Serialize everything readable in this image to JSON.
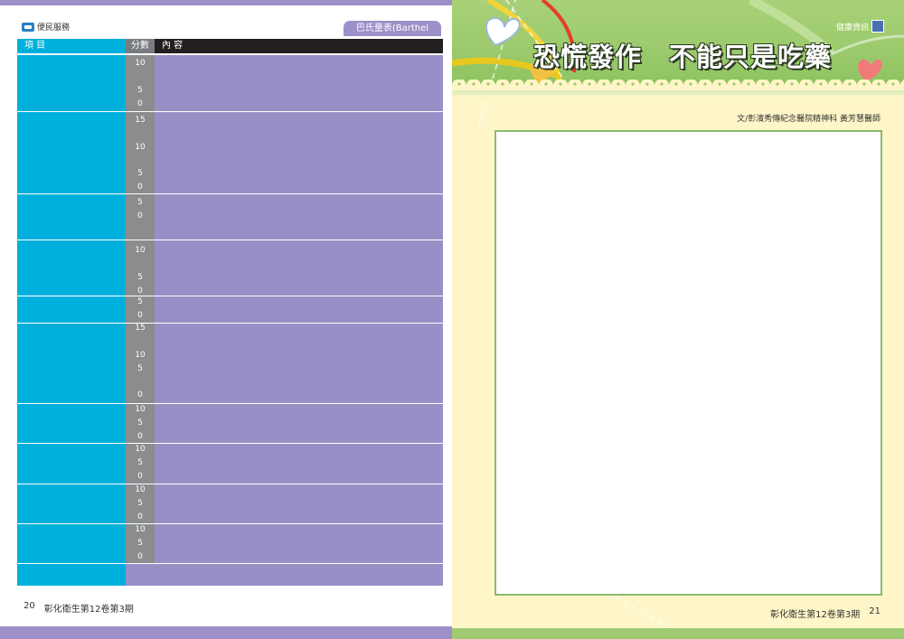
{
  "left_page": {
    "section_tag": "便民服務",
    "table_title": "巴氏量表(Barthel Index)",
    "headers": {
      "item": "項 目",
      "score": "分數",
      "content": "內 容"
    },
    "rows": [
      {
        "scores": [
          "10",
          "5",
          "0"
        ]
      },
      {
        "scores": [
          "15",
          "10",
          "5",
          "0"
        ]
      },
      {
        "scores": [
          "5",
          "0"
        ]
      },
      {
        "scores": [
          "10",
          "5",
          "0"
        ]
      },
      {
        "scores": [
          "5",
          "0"
        ]
      },
      {
        "scores": [
          "15",
          "10",
          "5",
          "0"
        ]
      },
      {
        "scores": [
          "10",
          "5",
          "0"
        ]
      },
      {
        "scores": [
          "10",
          "5",
          "0"
        ]
      },
      {
        "scores": [
          "10",
          "5",
          "0"
        ]
      },
      {
        "scores": [
          "10",
          "5",
          "0"
        ]
      },
      {
        "scores": []
      }
    ],
    "footer": {
      "page_number": "20",
      "publication": "彰化衛生第12卷第3期"
    }
  },
  "right_page": {
    "section_tag": "健康資訊",
    "title": "恐慌發作　不能只是吃藥",
    "author": "文/彰濱秀傳紀念醫院精神科 黃芳慧醫師",
    "footer": {
      "publication": "彰化衛生第12卷第3期",
      "page_number": "21"
    },
    "colors": {
      "banner_green": "#9bca6c",
      "page_cream": "#fef6c8",
      "table_cyan": "#00b0dc",
      "table_purple": "#998fc6",
      "score_gray": "#8a8c8e"
    }
  }
}
